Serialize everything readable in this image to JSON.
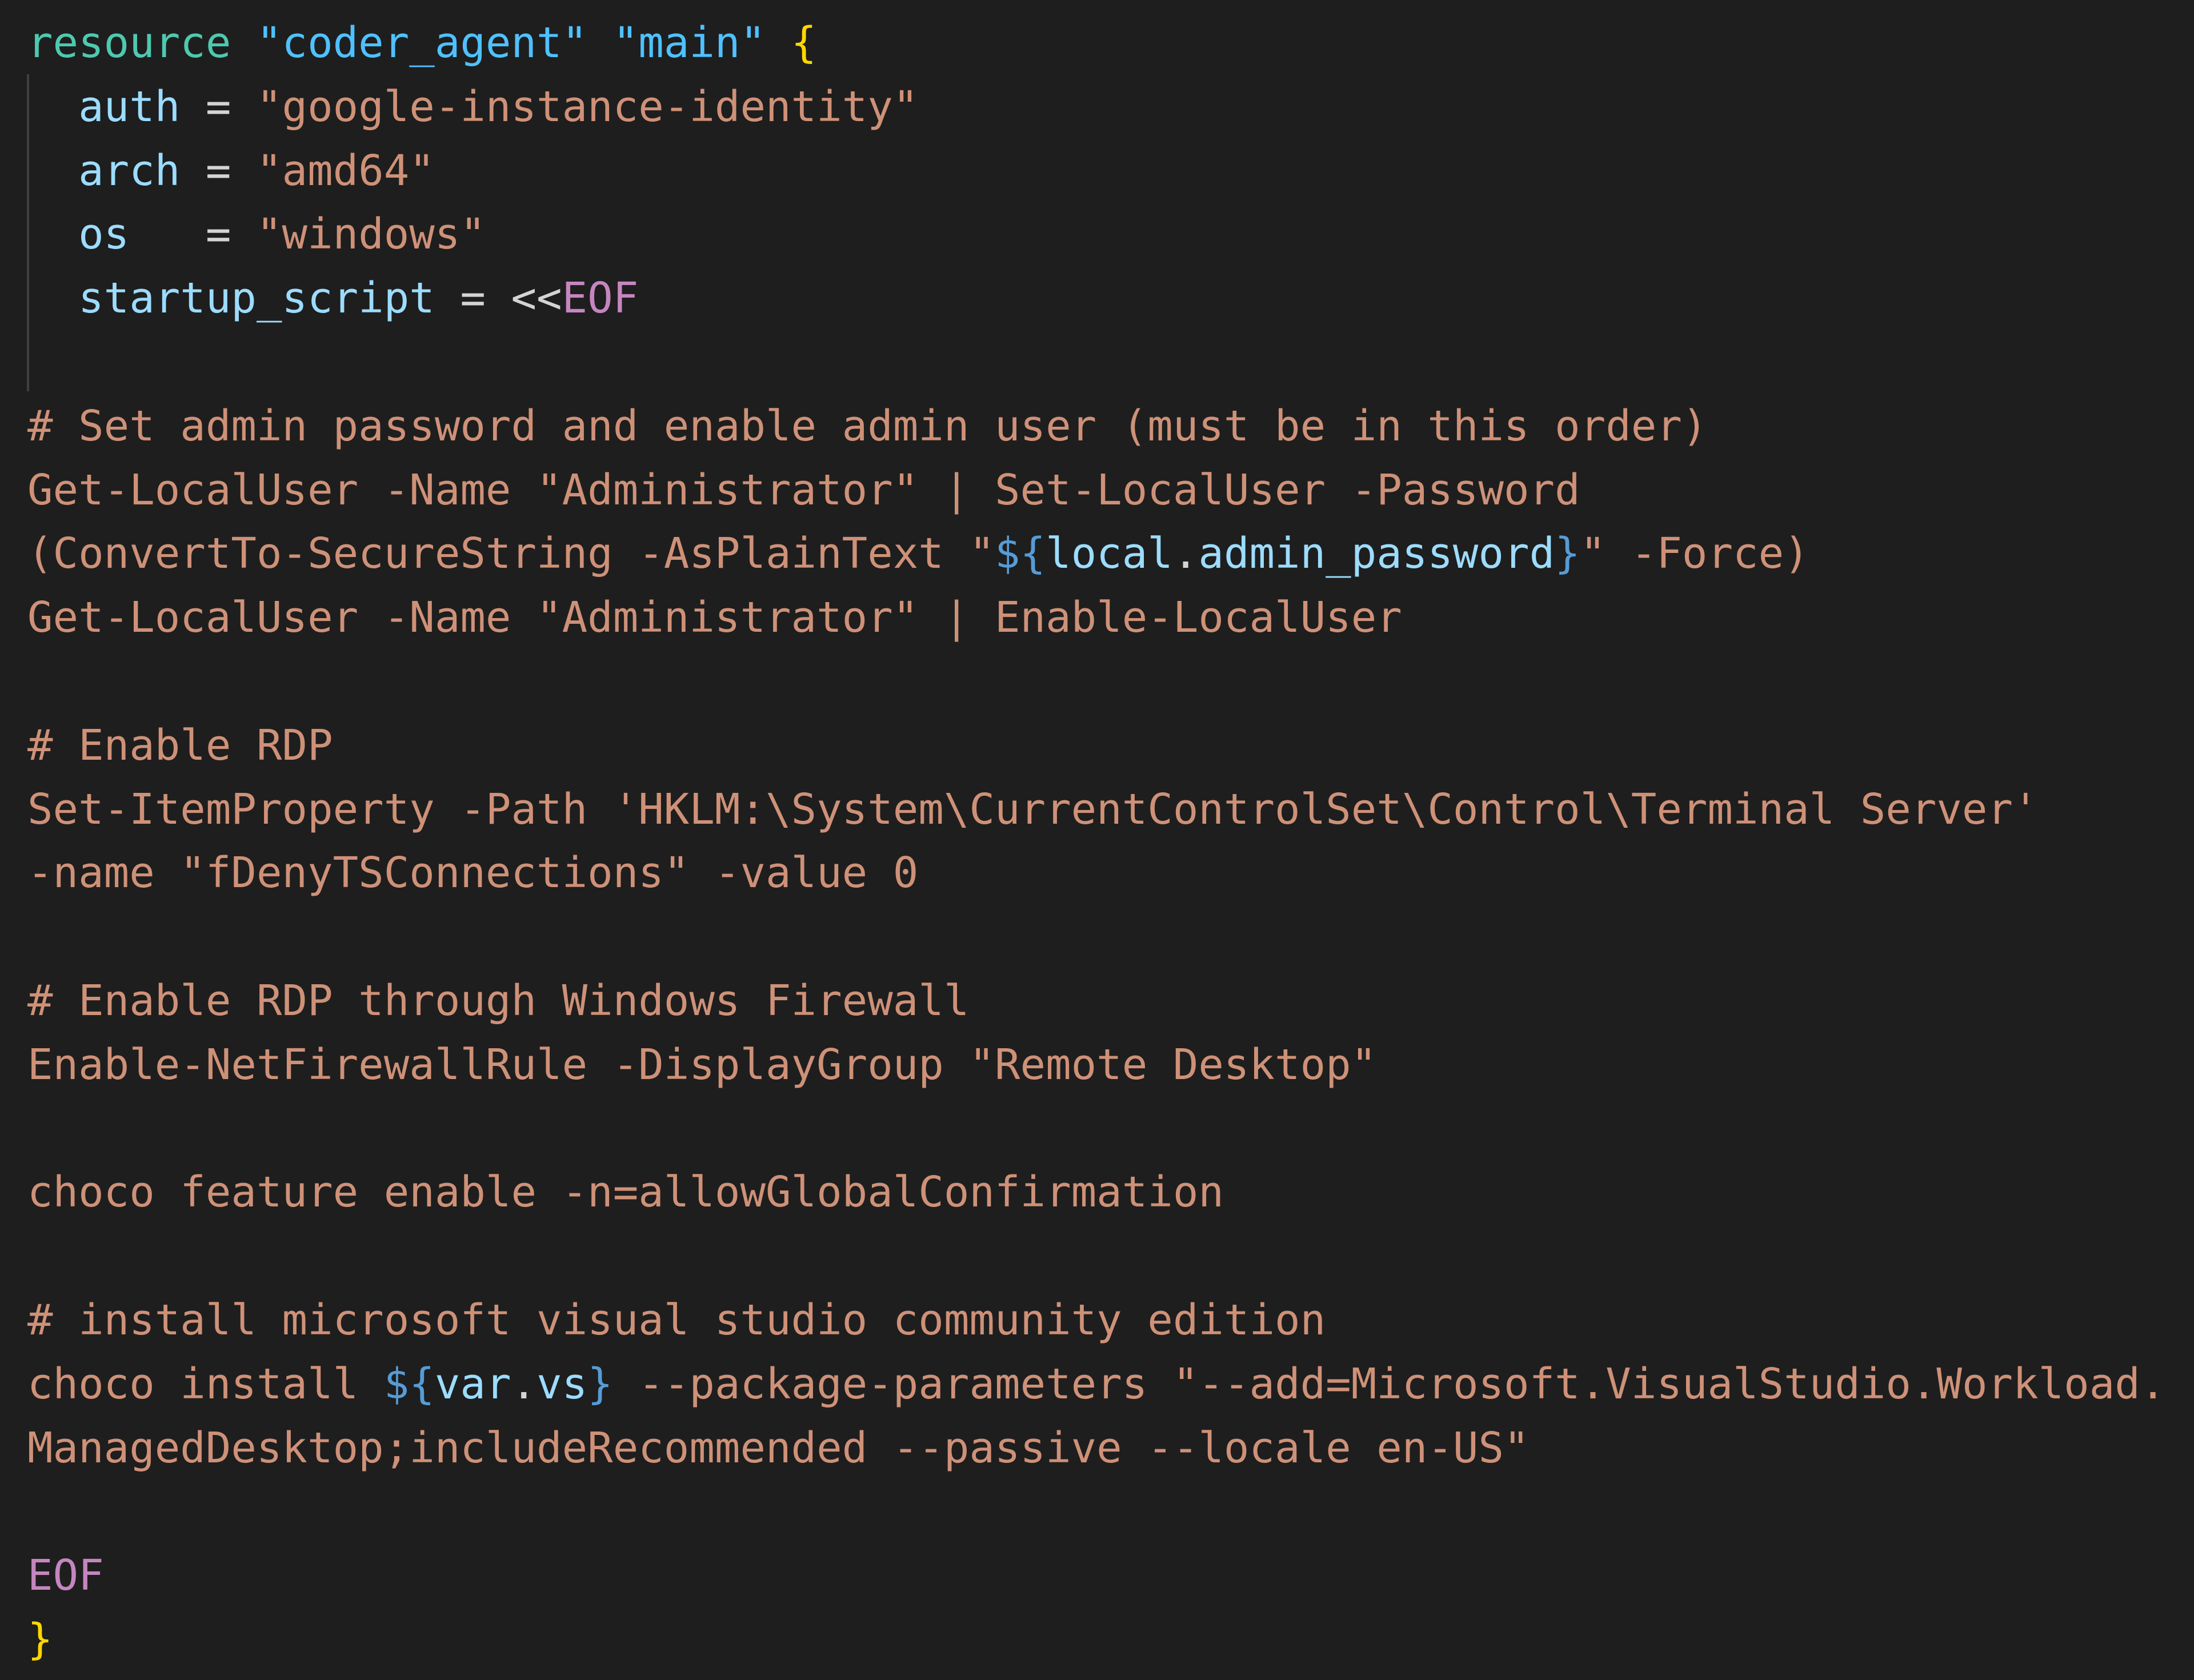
{
  "lines": [
    {
      "tokens": [
        {
          "t": "resource ",
          "c": "kw-green"
        },
        {
          "t": "\"coder_agent\"",
          "c": "str-blue"
        },
        {
          "t": " ",
          "c": "op"
        },
        {
          "t": "\"main\"",
          "c": "str-blue"
        },
        {
          "t": " ",
          "c": "op"
        },
        {
          "t": "{",
          "c": "brace"
        }
      ]
    },
    {
      "tokens": [
        {
          "t": "  auth",
          "c": "prop"
        },
        {
          "t": " = ",
          "c": "op"
        },
        {
          "t": "\"google-instance-identity\"",
          "c": "str"
        }
      ]
    },
    {
      "tokens": [
        {
          "t": "  arch",
          "c": "prop"
        },
        {
          "t": " = ",
          "c": "op"
        },
        {
          "t": "\"amd64\"",
          "c": "str"
        }
      ]
    },
    {
      "tokens": [
        {
          "t": "  os",
          "c": "prop"
        },
        {
          "t": "   = ",
          "c": "op"
        },
        {
          "t": "\"windows\"",
          "c": "str"
        }
      ]
    },
    {
      "tokens": [
        {
          "t": "  startup_script",
          "c": "prop"
        },
        {
          "t": " = <<",
          "c": "op"
        },
        {
          "t": "EOF",
          "c": "heredoc"
        }
      ]
    },
    {
      "tokens": []
    },
    {
      "tokens": [
        {
          "t": "# Set admin password and enable admin user (must be in this order)",
          "c": "str"
        }
      ]
    },
    {
      "tokens": [
        {
          "t": "Get-LocalUser -Name \"Administrator\" | Set-LocalUser -Password",
          "c": "str"
        }
      ]
    },
    {
      "tokens": [
        {
          "t": "(ConvertTo-SecureString -AsPlainText \"",
          "c": "str"
        },
        {
          "t": "${",
          "c": "interp"
        },
        {
          "t": "local",
          "c": "ivar"
        },
        {
          "t": ".",
          "c": "op"
        },
        {
          "t": "admin_password",
          "c": "ivar"
        },
        {
          "t": "}",
          "c": "interp"
        },
        {
          "t": "\" -Force)",
          "c": "str"
        }
      ]
    },
    {
      "tokens": [
        {
          "t": "Get-LocalUser -Name \"Administrator\" | Enable-LocalUser",
          "c": "str"
        }
      ]
    },
    {
      "tokens": []
    },
    {
      "tokens": [
        {
          "t": "# Enable RDP",
          "c": "str"
        }
      ]
    },
    {
      "tokens": [
        {
          "t": "Set-ItemProperty -Path 'HKLM:\\System\\CurrentControlSet\\Control\\Terminal Server'",
          "c": "str"
        }
      ]
    },
    {
      "tokens": [
        {
          "t": "-name \"fDenyTSConnections\" -value 0",
          "c": "str"
        }
      ]
    },
    {
      "tokens": []
    },
    {
      "tokens": [
        {
          "t": "# Enable RDP through Windows Firewall",
          "c": "str"
        }
      ]
    },
    {
      "tokens": [
        {
          "t": "Enable-NetFirewallRule -DisplayGroup \"Remote Desktop\"",
          "c": "str"
        }
      ]
    },
    {
      "tokens": []
    },
    {
      "tokens": [
        {
          "t": "choco feature enable -n=allowGlobalConfirmation",
          "c": "str"
        }
      ]
    },
    {
      "tokens": []
    },
    {
      "tokens": [
        {
          "t": "# install microsoft visual studio community edition",
          "c": "str"
        }
      ]
    },
    {
      "tokens": [
        {
          "t": "choco install ",
          "c": "str"
        },
        {
          "t": "${",
          "c": "interp"
        },
        {
          "t": "var",
          "c": "ivar"
        },
        {
          "t": ".",
          "c": "op"
        },
        {
          "t": "vs",
          "c": "ivar"
        },
        {
          "t": "}",
          "c": "interp"
        },
        {
          "t": " --package-parameters \"--add=Microsoft.VisualStudio.Workload.",
          "c": "str"
        }
      ]
    },
    {
      "tokens": [
        {
          "t": "ManagedDesktop;includeRecommended --passive --locale en-US\"",
          "c": "str"
        }
      ]
    },
    {
      "tokens": []
    },
    {
      "tokens": [
        {
          "t": "EOF",
          "c": "heredoc"
        }
      ]
    },
    {
      "tokens": [
        {
          "t": "}",
          "c": "brace"
        }
      ]
    }
  ]
}
